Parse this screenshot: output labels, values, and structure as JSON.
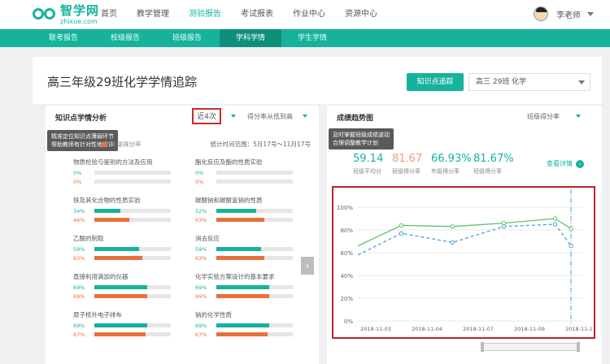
{
  "header": {
    "logo_cn": "智学网",
    "logo_en": "zhixue.com",
    "nav": [
      "首页",
      "教学管理",
      "测验报告",
      "考试报表",
      "作业中心",
      "资源中心"
    ],
    "active_nav": 2,
    "user_name": "李老师"
  },
  "subnav": {
    "items": [
      "联考报告",
      "校级报告",
      "班级报告",
      "学科学情",
      "学生学情"
    ],
    "active": 3
  },
  "page": {
    "title": "高三年级29班化学学情追踪",
    "report_button": "知识点追踪",
    "class_select": "高三 29班 化学"
  },
  "left_card": {
    "title": "知识点学情分析",
    "recent_tab": "近4次",
    "sort_label": "得分率从低到高",
    "tooltip": [
      "精准定位知识点薄弱环节",
      "帮助教师有针对性地讲评"
    ],
    "legend": "年级得分率",
    "date_range": "统计时间范围：5月17号～11月17号",
    "items": [
      {
        "name": "物质检验与鉴别的方法及应用",
        "class_pct": "0%",
        "grade_pct": "0%",
        "class_val": 0,
        "grade_val": 0
      },
      {
        "name": "酯化反应及酯的性质实验",
        "class_pct": "0%",
        "grade_pct": "0%",
        "class_val": 0,
        "grade_val": 0
      },
      {
        "name": "铁及其化合物的性质实验",
        "class_pct": "34%",
        "grade_pct": "46%",
        "class_val": 34,
        "grade_val": 46
      },
      {
        "name": "碳酸钠和碳酸氢钠的性质",
        "class_pct": "52%",
        "grade_pct": "63%",
        "class_val": 52,
        "grade_val": 63
      },
      {
        "name": "乙酸的制取",
        "class_pct": "59%",
        "grade_pct": "63%",
        "class_val": 59,
        "grade_val": 63
      },
      {
        "name": "消去反应",
        "class_pct": "59%",
        "grade_pct": "63%",
        "class_val": 59,
        "grade_val": 63
      },
      {
        "name": "直接利用滴加的仪器",
        "class_pct": "69%",
        "grade_pct": "69%",
        "class_val": 69,
        "grade_val": 69
      },
      {
        "name": "化学实验方案设计的基本要求",
        "class_pct": "69%",
        "grade_pct": "69%",
        "class_val": 69,
        "grade_val": 69
      },
      {
        "name": "原子核外电子排布",
        "class_pct": "69%",
        "grade_pct": "67%",
        "class_val": 69,
        "grade_val": 67
      },
      {
        "name": "钠的化学性质",
        "class_pct": "69%",
        "grade_pct": "67%",
        "class_val": 69,
        "grade_val": 67
      }
    ]
  },
  "right_card": {
    "title": "成绩趋势图",
    "select": "班级得分率",
    "tooltip": [
      "及时掌握班级成绩波动",
      "合理调整教学计划"
    ],
    "stats": [
      {
        "value": "59.14",
        "label": "班级平均分",
        "color": "#16b29c"
      },
      {
        "value": "81.67",
        "label": "班级得分率",
        "color": "#e8a080"
      },
      {
        "value": "66.93%",
        "label": "年级得分率",
        "color": "#16b29c"
      },
      {
        "value": "81.67%",
        "label": "班级得分率",
        "color": "#16b29c"
      }
    ],
    "detail_link": "查看详情"
  },
  "chart_data": {
    "type": "line",
    "x": [
      "2018-11-03",
      "2018-11-04",
      "2018-11-07",
      "2018-11-09",
      "2018-11-11"
    ],
    "series": [
      {
        "values": [
          66,
          84,
          83,
          86,
          90,
          81
        ],
        "style": "solid",
        "color": "#5ac36b"
      },
      {
        "values": [
          58,
          77,
          69,
          83,
          85,
          66
        ],
        "style": "dashed",
        "color": "#4aa0d8"
      }
    ],
    "y_ticks": [
      "0%",
      "20%",
      "40%",
      "60%",
      "80%",
      "100%"
    ],
    "ylim": [
      0,
      100
    ],
    "grid": true
  }
}
